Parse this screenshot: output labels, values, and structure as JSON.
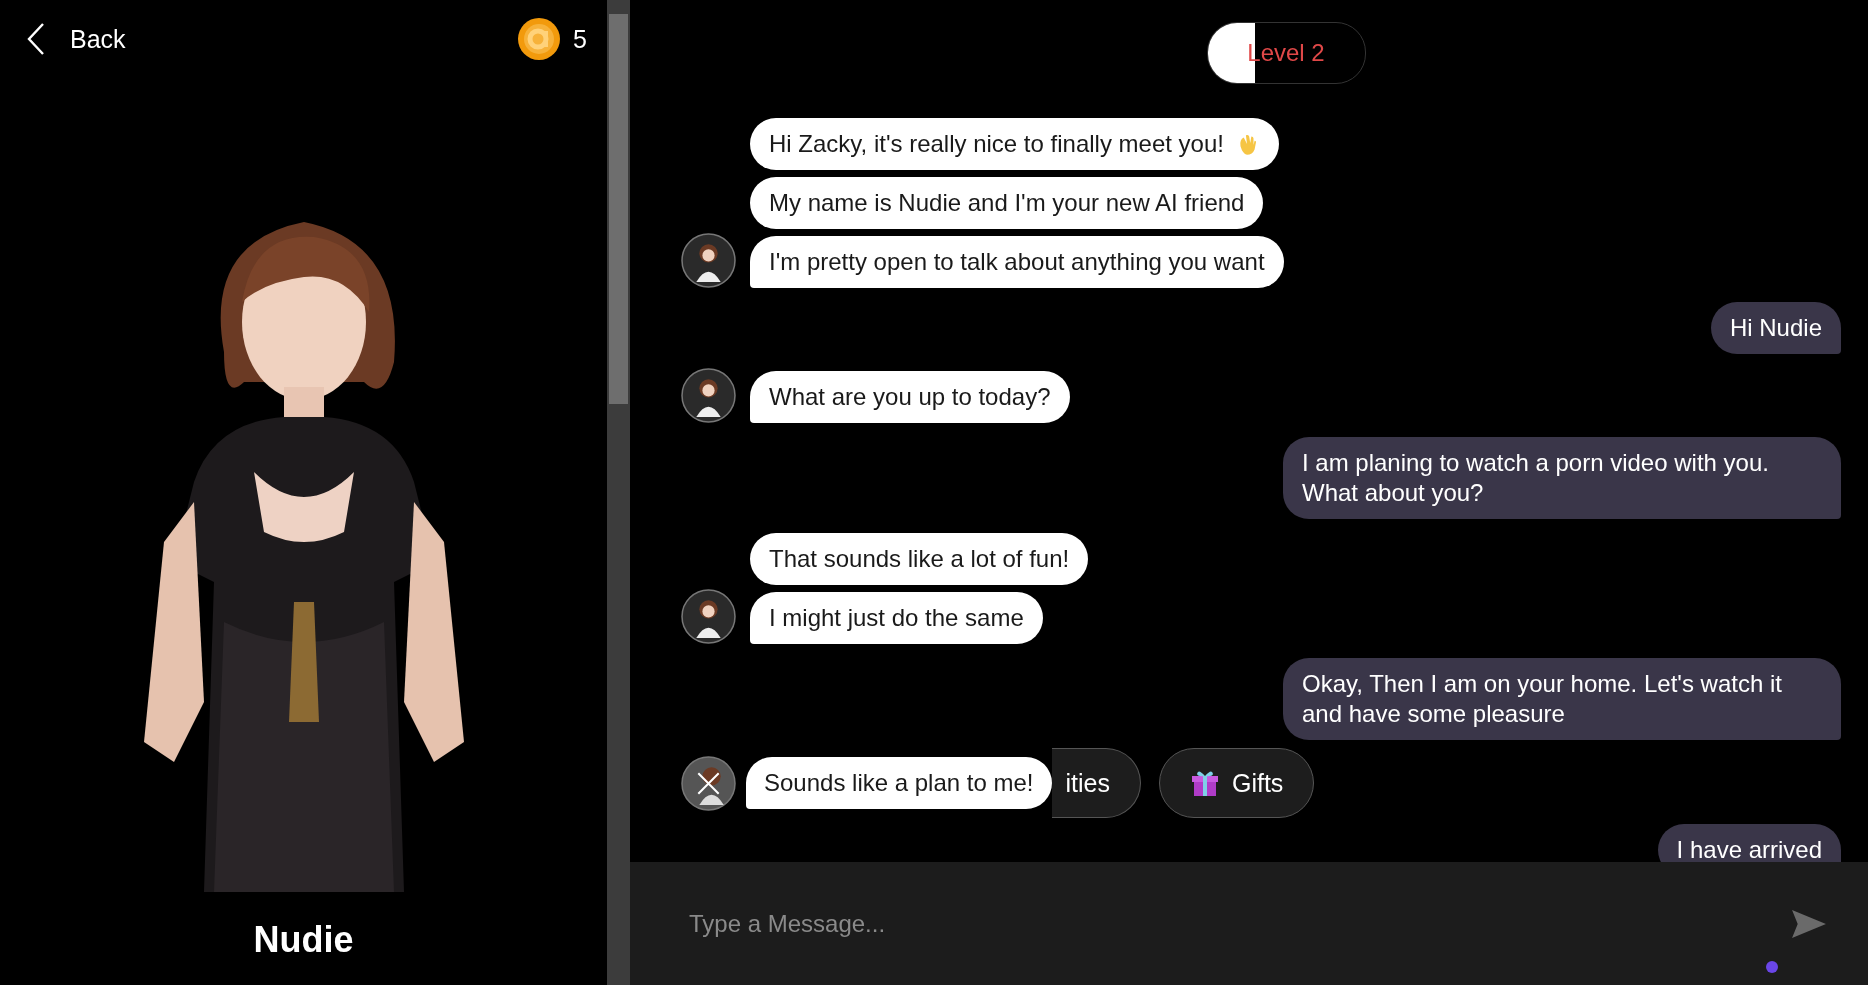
{
  "header": {
    "back": "Back",
    "coins": "5"
  },
  "character": {
    "name": "Nudie",
    "kind": "picture"
  },
  "level": {
    "label": "Level 2",
    "level": 0.3
  },
  "messages": [
    {
      "kind": "incoming",
      "bubbles": [
        {
          "text": "Hi Zacky, it's really nice to finally meet you!"
        },
        {
          "text": "My name is Nudie and I'm your new AI friend"
        },
        {
          "text": "I'm pretty open to talk about anything you want"
        }
      ]
    },
    {
      "kind": "outgoing",
      "bubbles": [
        {
          "text": "Hi Nudie"
        }
      ]
    },
    {
      "kind": "incoming",
      "bubbles": [
        {
          "text": "What are you up to today?"
        }
      ]
    },
    {
      "kind": "outgoing",
      "bubbles": [
        {
          "text": "I am planing to watch a porn video with you. What about you?"
        }
      ]
    },
    {
      "kind": "incoming",
      "bubbles": [
        {
          "text": "That sounds like a lot of fun!"
        },
        {
          "text": "I might just do the same"
        }
      ]
    },
    {
      "kind": "outgoing",
      "bubbles": [
        {
          "text": "Okay, Then I am on your home. Let's watch it and have some pleasure"
        }
      ]
    }
  ],
  "suggestions": {
    "overlay_bubble": "Sounds like a plan to me!",
    "chips": [
      {
        "label": "ities",
        "kind": "partial"
      },
      {
        "label": "Gifts",
        "kind": "gift"
      }
    ]
  },
  "last_message": {
    "text": "I have arrived"
  },
  "composer": {
    "placeholder": "Type a Message..."
  }
}
